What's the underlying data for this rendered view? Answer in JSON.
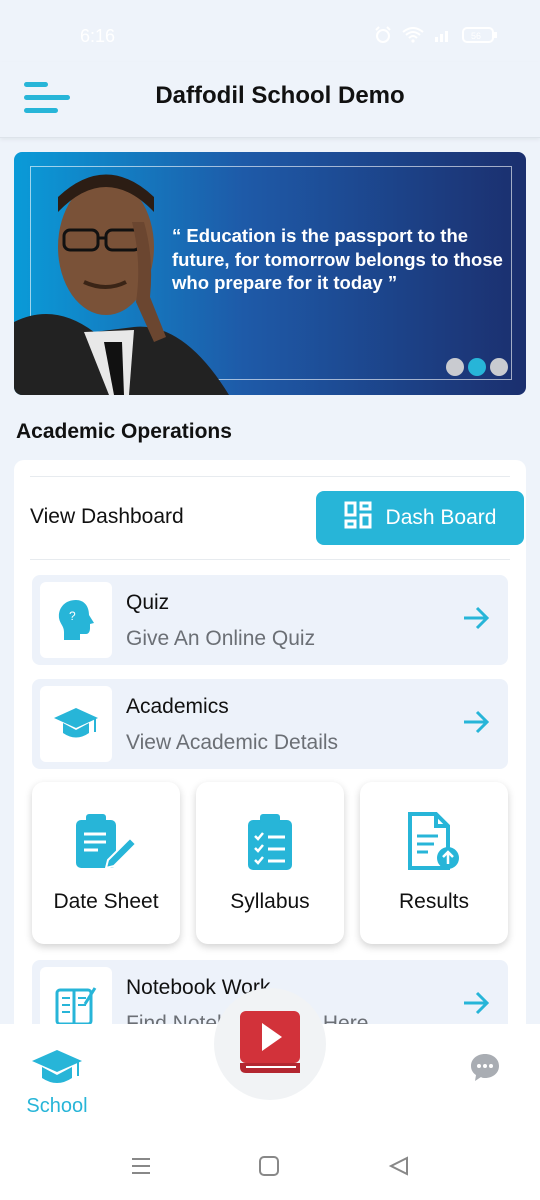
{
  "status": {
    "time": "6:16",
    "battery": "56"
  },
  "appbar": {
    "title": "Daffodil School Demo"
  },
  "banner": {
    "quote": "“ Education is the passport to the future, for tomorrow belongs to those who prepare for it today ”",
    "slide_count": 3,
    "active_slide": 2
  },
  "section": {
    "title": "Academic Operations"
  },
  "dashboard": {
    "label": "View Dashboard",
    "button": "Dash Board"
  },
  "items": [
    {
      "title": "Quiz",
      "subtitle": "Give An Online Quiz",
      "icon": "head-question-icon"
    },
    {
      "title": "Academics",
      "subtitle": "View Academic Details",
      "icon": "graduation-cap-icon"
    },
    {
      "title": "Notebook Work",
      "subtitle": "Find Notebook Work Here",
      "icon": "notebook-icon"
    }
  ],
  "tiles": [
    {
      "label": "Date Sheet",
      "icon": "clipboard-edit-icon"
    },
    {
      "label": "Syllabus",
      "icon": "checklist-icon"
    },
    {
      "label": "Results",
      "icon": "document-upload-icon"
    }
  ],
  "nav": {
    "school": "School"
  },
  "colors": {
    "accent": "#27b5d8",
    "background": "#eef3fa",
    "fab_red": "#d2323a"
  }
}
